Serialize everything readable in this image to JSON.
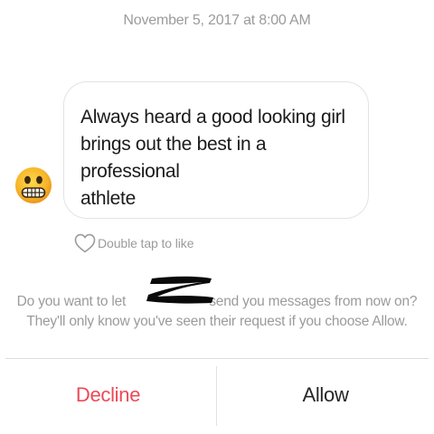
{
  "timestamp": "November 5, 2017 at 8:00 AM",
  "message": {
    "text": "Always heard a good looking girl brings out the best in a professional athlete",
    "lines": [
      "Always heard a good looking girl",
      "brings out the best in a professional",
      "athlete"
    ],
    "avatar_icon": "grimacing-face-emoji"
  },
  "like": {
    "icon": "heart-outline-icon",
    "label": "Double tap to like"
  },
  "request": {
    "line1_prefix": "Do you want to let ",
    "line1_suffix": "send you messages from now on?",
    "line2": "They'll only know you've seen their request if you choose Allow."
  },
  "actions": {
    "decline_label": "Decline",
    "allow_label": "Allow"
  },
  "colors": {
    "decline": "#ed4956",
    "allow": "#262626",
    "muted_text": "#9b9b9b",
    "bubble_border": "#e3e3e3"
  }
}
